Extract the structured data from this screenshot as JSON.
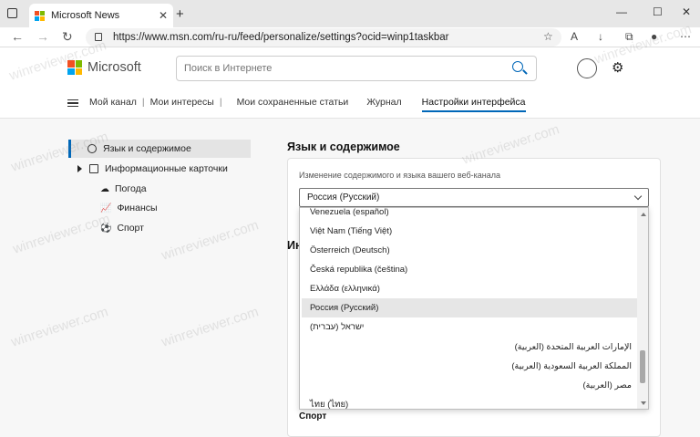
{
  "browser": {
    "tab_title": "Microsoft News",
    "url": "https://www.msn.com/ru-ru/feed/personalize/settings?ocid=winp1taskbar"
  },
  "header": {
    "brand": "Microsoft",
    "search_placeholder": "Поиск в Интернете"
  },
  "nav": {
    "links": [
      "Мой канал",
      "Мои интересы",
      "Мои сохраненные статьи",
      "Журнал",
      "Настройки интерфейса"
    ]
  },
  "sidebar": {
    "items": [
      {
        "label": "Язык и содержимое"
      },
      {
        "label": "Информационные карточки"
      },
      {
        "label": "Погода"
      },
      {
        "label": "Финансы"
      },
      {
        "label": "Спорт"
      }
    ]
  },
  "main": {
    "title": "Язык и содержимое",
    "card_label": "Изменение содержимого и языка вашего веб-канала",
    "selected_value": "Россия (Русский)",
    "behind_heading": "Ин",
    "behind_sport": "Спорт"
  },
  "dropdown": {
    "options": [
      "Venezuela (español)",
      "Việt Nam (Tiếng Việt)",
      "Österreich (Deutsch)",
      "Česká republika (čeština)",
      "Ελλάδα (ελληνικά)",
      "Россия (Русский)",
      "ישראל (עברית)",
      "الإمارات العربية المتحدة (العربية)",
      "المملكة العربية السعودية (العربية)",
      "مصر (العربية)",
      "ไทย (ไทย)"
    ]
  },
  "watermark": "winreviewer.com",
  "icons": [
    "tab-actions-icon",
    "back-icon",
    "forward-icon",
    "refresh-icon",
    "lock-icon",
    "favorite-icon",
    "read-aloud-icon",
    "downloads-icon",
    "collections-icon",
    "profile-icon",
    "more-icon",
    "search-icon",
    "account-icon",
    "gear-icon",
    "hamburger-icon",
    "globe-icon",
    "card-icon",
    "weather-icon",
    "finance-icon",
    "sport-icon"
  ],
  "colors": {
    "accent": "#0067b8",
    "selected_bg": "#e6e6e6"
  }
}
